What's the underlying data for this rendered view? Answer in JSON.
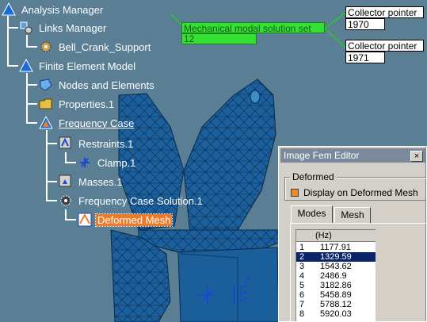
{
  "tree": {
    "analysis_manager": "Analysis Manager",
    "links_manager": "Links Manager",
    "bell_crank": "Bell_Crank_Support",
    "fem": "Finite Element Model",
    "nodes_elements": "Nodes and Elements",
    "properties": "Properties.1",
    "frequency_case": "Frequency Case",
    "restraints": "Restraints.1",
    "clamp": "Clamp.1",
    "masses": "Masses.1",
    "solution": "Frequency Case Solution.1",
    "deformed_mesh": "Deformed Mesh"
  },
  "callouts": {
    "green_title": "Mechanical modal solution set",
    "green_value": "12",
    "collector1_title": "Collector pointer",
    "collector1_value": "1970",
    "collector2_title": "Collector pointer",
    "collector2_value": "1971"
  },
  "dialog": {
    "title": "Image Fem Editor",
    "close_label": "×",
    "group_label": "Deformed",
    "checkbox_label": "Display on Deformed Mesh",
    "tabs": [
      "Modes",
      "Mesh"
    ],
    "column_header": "(Hz)",
    "rows": [
      {
        "n": "1",
        "v": "1177.91"
      },
      {
        "n": "2",
        "v": "1329.59"
      },
      {
        "n": "3",
        "v": "1543.62"
      },
      {
        "n": "4",
        "v": "2486.9"
      },
      {
        "n": "5",
        "v": "3182.86"
      },
      {
        "n": "6",
        "v": "5458.89"
      },
      {
        "n": "7",
        "v": "5788.12"
      },
      {
        "n": "8",
        "v": "5920.03"
      }
    ],
    "selected_row": "2"
  },
  "colors": {
    "background": "#5a7e93",
    "mesh": "#1a5e9a",
    "selection": "#f07a28",
    "green_callout": "#34e034"
  }
}
